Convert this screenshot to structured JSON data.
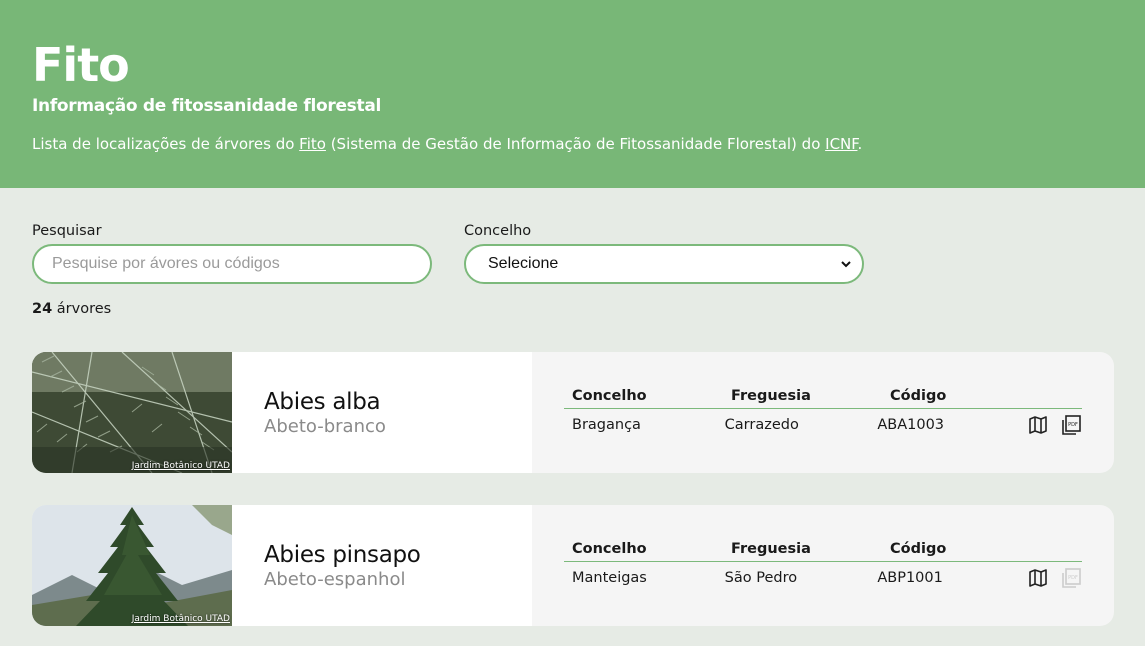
{
  "header": {
    "title": "Fito",
    "subtitle": "Informação de fitossanidade florestal",
    "desc_prefix": "Lista de localizações de árvores do ",
    "fito_link": "Fito",
    "desc_middle": " (Sistema de Gestão de Informação de Fitossanidade Florestal) do ",
    "icnf_link": "ICNF",
    "desc_suffix": "."
  },
  "colors": {
    "header_bg": "#78b777",
    "page_bg": "#e6ebe5",
    "accent": "#7cb97b"
  },
  "search": {
    "label": "Pesquisar",
    "placeholder": "Pesquise por ávores ou códigos",
    "value": ""
  },
  "county": {
    "label": "Concelho",
    "selected": "Selecione"
  },
  "results": {
    "count": "24",
    "count_label": " árvores"
  },
  "columns": {
    "county": "Concelho",
    "parish": "Freguesia",
    "code": "Código"
  },
  "trees": [
    {
      "scientific": "Abies alba",
      "common": "Abeto-branco",
      "credit": "Jardim Botânico UTAD",
      "county": "Bragança",
      "parish": "Carrazedo",
      "code": "ABA1003",
      "icons": [
        "map-icon",
        "pdf-icon"
      ],
      "pdf_enabled": true
    },
    {
      "scientific": "Abies pinsapo",
      "common": "Abeto-espanhol",
      "credit": "Jardim Botânico UTAD",
      "county": "Manteigas",
      "parish": "São Pedro",
      "code": "ABP1001",
      "icons": [
        "map-icon",
        "pdf-icon"
      ],
      "pdf_enabled": false
    }
  ]
}
